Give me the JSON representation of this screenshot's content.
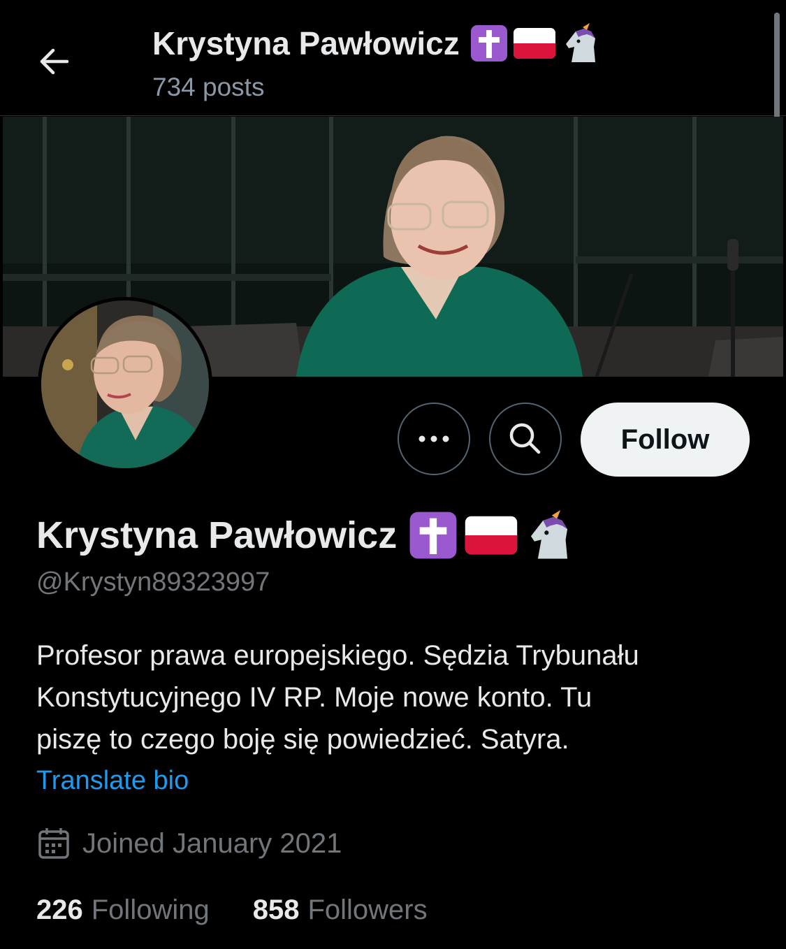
{
  "header": {
    "title": "Krystyna Pawłowicz",
    "post_count": "734 posts",
    "emoji_icons": [
      "latin-cross-icon",
      "poland-flag-icon",
      "unicorn-icon"
    ]
  },
  "profile": {
    "display_name": "Krystyna Pawłowicz",
    "handle": "@Krystyn89323997",
    "bio_lines": [
      "Profesor prawa europejskiego. Sędzia Trybunału",
      "Konstytucyjnego IV RP. Moje nowe konto. Tu",
      "piszę to czego boję się powiedzieć. Satyra."
    ],
    "translate_label": "Translate bio",
    "joined": "Joined January 2021",
    "following_count": "226",
    "following_label": "Following",
    "followers_count": "858",
    "followers_label": "Followers"
  },
  "actions": {
    "follow_label": "Follow",
    "more_icon": "more-icon",
    "search_icon": "search-icon"
  },
  "colors": {
    "background": "#000000",
    "link": "#1d9bf0",
    "muted": "#71767b",
    "follow_button_bg": "#eff3f4",
    "emoji_purple": "#9b59d0",
    "flag_red": "#dc143c"
  }
}
